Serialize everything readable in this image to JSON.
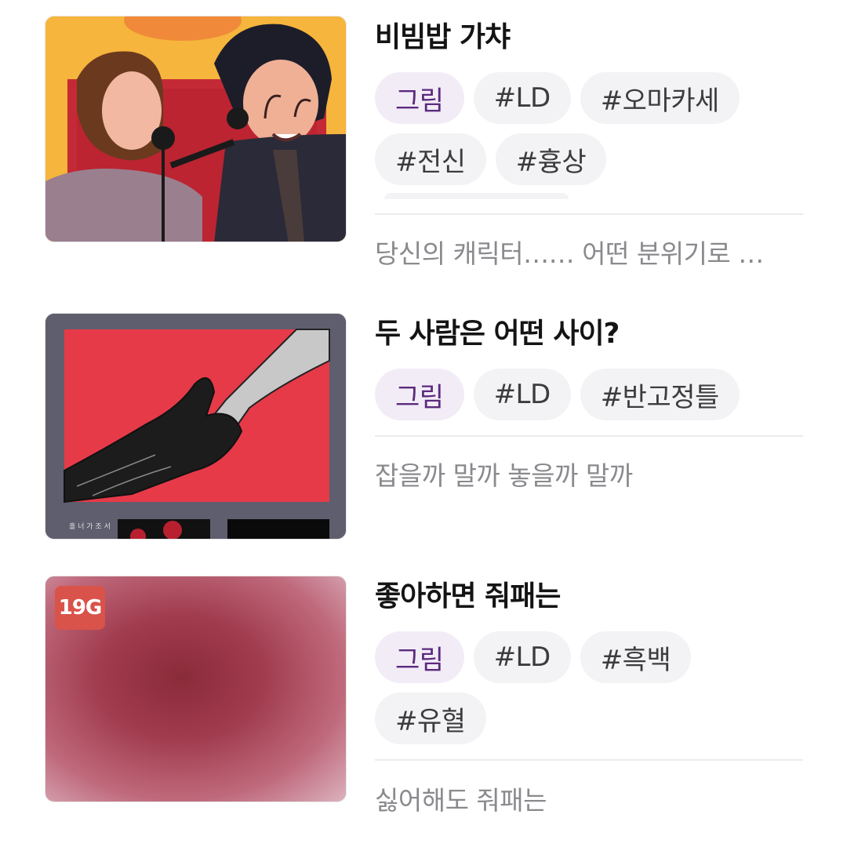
{
  "items": [
    {
      "title": "비빔밥 가챠",
      "tags": [
        "그림",
        "#LD",
        "#오마카세",
        "#전신",
        "#흉상"
      ],
      "description": "당신의 캐릭터…… 어떤 분위기로 …",
      "thumbnail": "illustration of two characters singing into microphones",
      "badge": ""
    },
    {
      "title": "두 사람은 어떤 사이?",
      "tags": [
        "그림",
        "#LD",
        "#반고정틀"
      ],
      "description": "잡을까 말까 놓을까 말까",
      "thumbnail": "illustration of two hands clasping on red background",
      "badge": ""
    },
    {
      "title": "좋아하면 줘패는",
      "tags": [
        "그림",
        "#LD",
        "#흑백",
        "#유혈"
      ],
      "description": "싫어해도 줘패는",
      "thumbnail": "blurred adult content thumbnail",
      "badge": "19G"
    }
  ],
  "colors": {
    "genre_tag_bg": "#f2ecf7",
    "genre_tag_text": "#5b2a7d",
    "tag_bg": "#f3f3f5",
    "badge_bg": "#d9534a"
  }
}
